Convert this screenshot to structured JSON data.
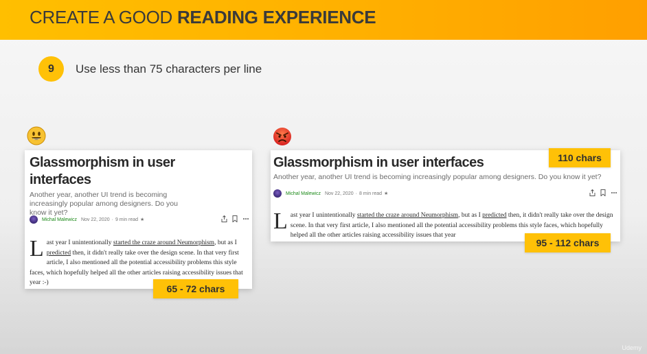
{
  "header": {
    "title_light": "CREATE A GOOD",
    "title_bold": "READING EXPERIENCE"
  },
  "tip": {
    "number": "9",
    "text": "Use less than 75 characters per line"
  },
  "good_example": {
    "emoji": "smiling-face-icon",
    "title": "Glassmorphism in user interfaces",
    "subtitle": "Another year, another UI trend is becoming increasingly popular among designers. Do you know it yet?",
    "author": "Michal Malewicz",
    "date": "Nov 22, 2020",
    "read_time": "9 min read",
    "star": "★",
    "dropcap": "L",
    "body_part1": "ast year I unintentionally ",
    "body_link1": "started the craze around Neumorphism",
    "body_part2": ", but as I ",
    "body_link2": "predicted",
    "body_part3": " then, it didn't really take over the design scene. In that very first article, I also mentioned all the potential accessibility problems this style faces, which hopefully helped all the other articles raising accessibility issues that year :-)",
    "label": "65 - 72 chars"
  },
  "bad_example": {
    "emoji": "angry-face-icon",
    "title": "Glassmorphism in user interfaces",
    "subtitle": "Another year, another UI trend is becoming increasingly popular among designers. Do you know it yet?",
    "author": "Michal Malewicz",
    "date": "Nov 22, 2020",
    "read_time": "8 min read",
    "star": "★",
    "dropcap": "L",
    "body_part1": "ast year I unintentionally ",
    "body_link1": "started the craze around Neumorphism",
    "body_part2": ", but as I ",
    "body_link2": "predicted",
    "body_part3": " then, it didn't really take over the design scene. In that very first article, I also mentioned all the potential accessibility problems this style faces, which hopefully helped all the other articles raising accessibility issues that year",
    "label_top": "110 chars",
    "label_bottom": "95 - 112 chars"
  },
  "icons": {
    "share": "share-icon",
    "bookmark": "bookmark-icon",
    "more": "more-icon"
  },
  "watermark": "Udemy",
  "colors": {
    "header_start": "#ffbf00",
    "header_end": "#ff9f00",
    "badge": "#ffc107",
    "label": "#ffc107",
    "author": "#1a8917"
  }
}
